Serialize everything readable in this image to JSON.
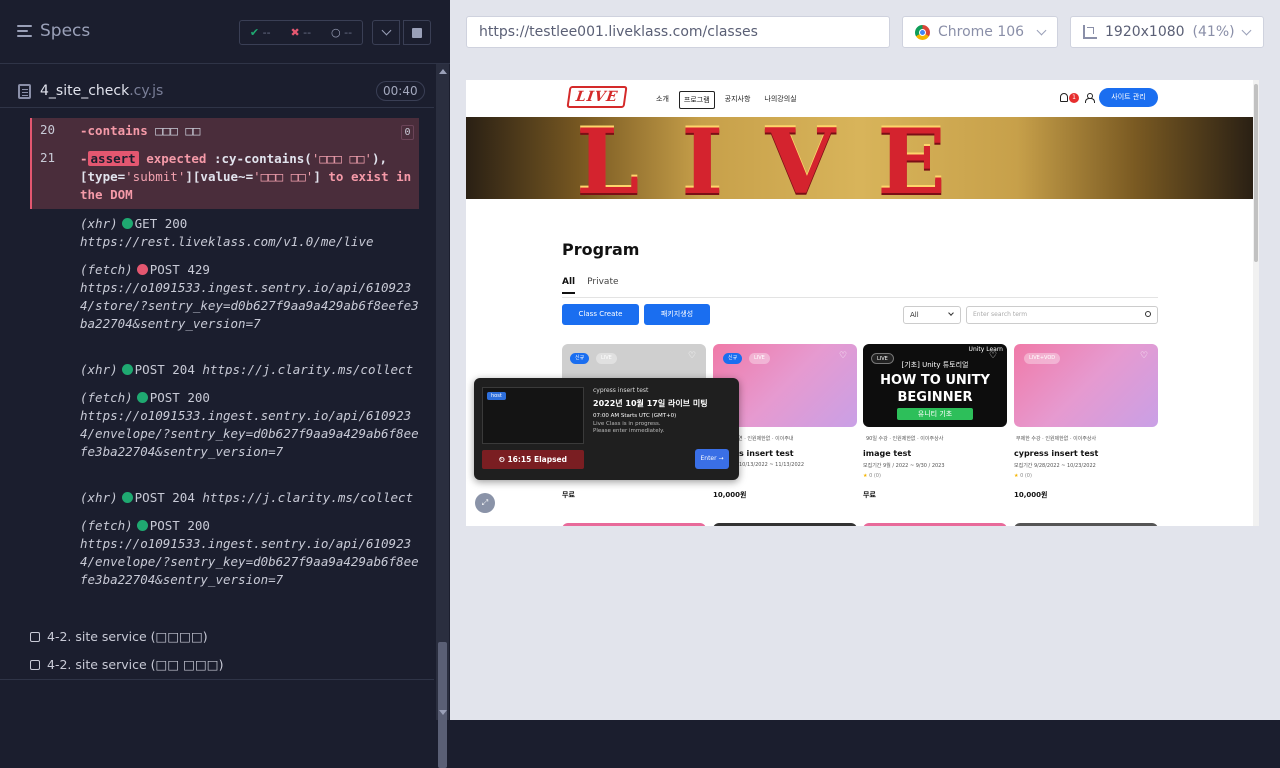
{
  "reporter": {
    "specs_label": "Specs",
    "stats": {
      "passed": "--",
      "failed": "--",
      "pending": "--"
    },
    "file": {
      "name": "4_site_check",
      "ext": ".cy.js",
      "duration": "00:40"
    },
    "error_block": {
      "line20_num": "20",
      "line20_cmd": "-contains",
      "line20_arg": "□□□ □□",
      "line20_count": "0",
      "line21_num": "21",
      "line21_dash": "-",
      "line21_badge": "assert",
      "line21_text1": "expected",
      "line21_text2": ":cy-contains(",
      "line21_str1": "'□□□ □□'",
      "line21_text3": "),",
      "line21_text4": "[type=",
      "line21_str2": "'submit'",
      "line21_text5": "][value~=",
      "line21_str3": "'□□□ □□'",
      "line21_text6": "]",
      "line21_text7": "to exist in",
      "line21_text8": "the DOM"
    },
    "logs": [
      {
        "type": "(xhr)",
        "status": "green",
        "method": "GET 200",
        "url": "https://rest.liveklass.com/v1.0/me/live"
      },
      {
        "type": "(fetch)",
        "status": "red",
        "method": "POST 429",
        "url": "https://o1091533.ingest.sentry.io/api/6109234/store/?sentry_key=d0b627f9aa9a429ab6f8eefe3ba22704&sentry_version=7"
      },
      {
        "type": "(xhr)",
        "status": "green",
        "method": "POST 204",
        "url": "https://j.clarity.ms/collect"
      },
      {
        "type": "(fetch)",
        "status": "green",
        "method": "POST 200",
        "url": "https://o1091533.ingest.sentry.io/api/6109234/envelope/?sentry_key=d0b627f9aa9a429ab6f8eefe3ba22704&sentry_version=7"
      },
      {
        "type": "(xhr)",
        "status": "green",
        "method": "POST 204",
        "url": "https://j.clarity.ms/collect"
      },
      {
        "type": "(fetch)",
        "status": "green",
        "method": "POST 200",
        "url": "https://o1091533.ingest.sentry.io/api/6109234/envelope/?sentry_key=d0b627f9aa9a429ab6f8eefe3ba22704&sentry_version=7"
      }
    ],
    "tests": [
      {
        "label": "4-2. site service (□□□□)"
      },
      {
        "label": "4-2. site service (□□ □□□)"
      }
    ]
  },
  "browser": {
    "url": "https://testlee001.liveklass.com/classes",
    "browser_name": "Chrome 106",
    "viewport": "1920x1080",
    "scale": "(41%)"
  },
  "site": {
    "logo": "LIVE",
    "nav": [
      "소개",
      "프로그램",
      "공지사항",
      "나의강의실"
    ],
    "bell_count": "1",
    "admin_button": "사이트 관리",
    "banner_text": "LIVE",
    "program_title": "Program",
    "tabs": [
      "All",
      "Private"
    ],
    "class_create": "Class Create",
    "package_create": "패키지생성",
    "filter_value": "All",
    "search_placeholder": "Enter search term",
    "cards": [
      {
        "tags": [
          "신규",
          "LIVE"
        ],
        "meta": "",
        "title": "",
        "date": "",
        "stars": "",
        "price": "무료"
      },
      {
        "tags": [
          "신규",
          "LIVE"
        ],
        "meta": "연 · 인원제한없 · 이이주내",
        "title": "s insert test",
        "date": "10/13/2022 ~ 11/13/2022",
        "stars": "",
        "price": "10,000원"
      },
      {
        "tags": [
          "LIVE"
        ],
        "meta": "90일 수강 · 인원제한없 · 이이주상사",
        "title": "image test",
        "date": "모집기간 9월 / 2022 ~ 9/30 / 2023",
        "stars": "0 (0)",
        "price": "무료",
        "unity_logo": "Unity Learn",
        "unity_title": "[기초] Unity 튜토리얼",
        "unity_big1": "HOW TO UNITY",
        "unity_big2": "BEGINNER",
        "unity_btn": "유니티 기초"
      },
      {
        "tags": [
          "LIVE+VOD"
        ],
        "meta": "무제한 수강 · 인원제한없 · 이이주상사",
        "title": "cypress insert test",
        "date": "모집기간 9/28/2022 ~ 10/23/2022",
        "stars": "0 (0)",
        "price": "10,000원"
      }
    ],
    "popup": {
      "host_tag": "host",
      "subtitle": "cypress insert test",
      "title": "2022년 10월 17일 라이브 미팅",
      "time": "07:00 AM Starts UTC (GMT+0)",
      "info1": "Live Class is in progress.",
      "info2": "Please enter immediately.",
      "elapsed": "16:15 Elapsed",
      "enter": "Enter →"
    }
  },
  "colors": {
    "pass": "#1fa971",
    "fail": "#e45770",
    "accent": "#1a6ef0"
  }
}
